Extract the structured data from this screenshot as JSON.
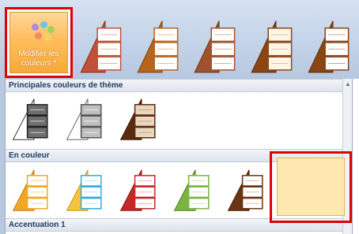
{
  "modify_button": {
    "label": "Modifier les couleurs *"
  },
  "sections": [
    {
      "title": "Principales couleurs de thème"
    },
    {
      "title": "En couleur"
    },
    {
      "title": "Accentuation 1"
    }
  ],
  "colors": {
    "highlight_border": "#e00000",
    "selected_fill": "#ffe8b0",
    "header_text": "#1f3b63"
  }
}
